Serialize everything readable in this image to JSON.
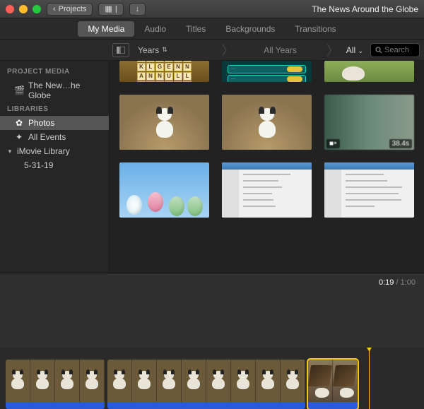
{
  "titlebar": {
    "back_label": "Projects",
    "title": "The News Around the Globe"
  },
  "tabs": [
    {
      "label": "My Media",
      "active": true
    },
    {
      "label": "Audio",
      "active": false
    },
    {
      "label": "Titles",
      "active": false
    },
    {
      "label": "Backgrounds",
      "active": false
    },
    {
      "label": "Transitions",
      "active": false
    }
  ],
  "filter": {
    "scope": "Years",
    "range": "All Years",
    "all_label": "All",
    "search_placeholder": "Search"
  },
  "sidebar": {
    "sections": [
      {
        "header": "PROJECT MEDIA",
        "items": [
          {
            "icon": "clapper",
            "label": "The New…he Globe"
          }
        ]
      },
      {
        "header": "LIBRARIES",
        "items": [
          {
            "icon": "flower",
            "label": "Photos",
            "selected": true
          },
          {
            "icon": "star",
            "label": "All Events"
          },
          {
            "icon": "disclosure",
            "label": "iMovie Library",
            "expanded": true,
            "children": [
              {
                "label": "5-31-19"
              }
            ]
          }
        ]
      }
    ]
  },
  "media": [
    {
      "kind": "word-tiles"
    },
    {
      "kind": "game-bars"
    },
    {
      "kind": "grass-dog"
    },
    {
      "kind": "carpet-dog"
    },
    {
      "kind": "carpet-dog"
    },
    {
      "kind": "blur-video",
      "duration": "38.4s",
      "is_video": true
    },
    {
      "kind": "sky-eggs"
    },
    {
      "kind": "app-window"
    },
    {
      "kind": "app-window"
    }
  ],
  "timeline": {
    "current": "0:19",
    "total": "1:00",
    "clips": [
      {
        "frames": 4,
        "kind": "dog-sit"
      },
      {
        "frames": 8,
        "kind": "dog-sit"
      },
      {
        "frames": 2,
        "kind": "dog-table",
        "selected": true
      }
    ]
  }
}
